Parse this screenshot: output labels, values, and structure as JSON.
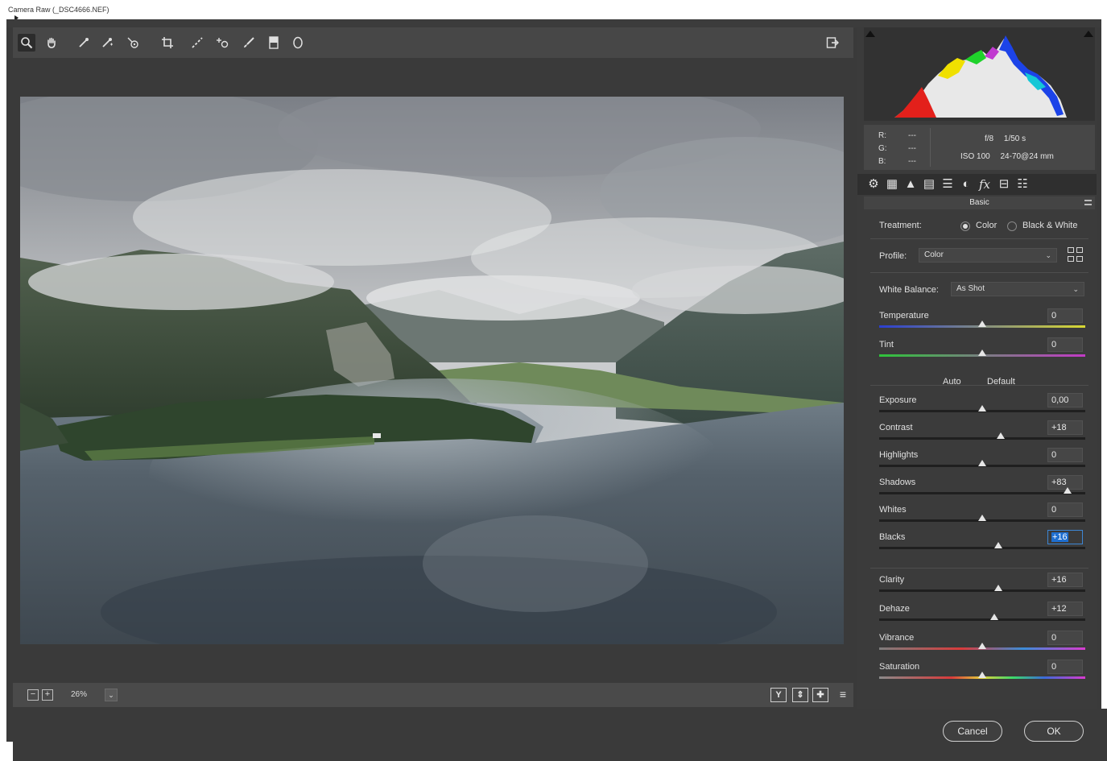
{
  "window": {
    "title": "Camera Raw (_DSC4666.NEF)"
  },
  "toolbar": {
    "tools": [
      {
        "name": "zoom-tool",
        "glyph": "🔍︎"
      },
      {
        "name": "hand-tool",
        "glyph": "✋︎"
      },
      {
        "name": "white-balance-tool",
        "glyph": "⁄"
      },
      {
        "name": "color-sampler-tool",
        "glyph": "⁄"
      },
      {
        "name": "targeted-adjustment-tool",
        "glyph": "◎"
      },
      {
        "name": "crop-tool",
        "glyph": "⌗"
      },
      {
        "name": "straighten-tool",
        "glyph": "⟋"
      },
      {
        "name": "spot-removal-tool",
        "glyph": "⊹"
      },
      {
        "name": "adjustment-brush-tool",
        "glyph": "╱"
      },
      {
        "name": "graduated-filter-tool",
        "glyph": "▣"
      },
      {
        "name": "radial-filter-tool",
        "glyph": "○"
      }
    ],
    "open_preferences_glyph": "⧉"
  },
  "bottom_bar": {
    "zoom_out": "−",
    "zoom_in": "+",
    "zoom_level": "26%",
    "zoom_arrow": "⌄",
    "view_buttons": [
      "Y",
      "⇕",
      "✚",
      "≡"
    ]
  },
  "histogram": {
    "rgb_labels": [
      "R:",
      "G:",
      "B:"
    ],
    "rgb_values": [
      "---",
      "---",
      "---"
    ],
    "aperture": "f/8",
    "shutter": "1/50 s",
    "iso": "ISO 100",
    "lens": "24-70@24 mm"
  },
  "tabs": [
    "⚙",
    "▦",
    "▲",
    "▤",
    "☰",
    "◐",
    "fx",
    "⊟",
    "☷"
  ],
  "panel": {
    "title": "Basic",
    "treatment_label": "Treatment:",
    "treatment_color": "Color",
    "treatment_bw": "Black & White",
    "profile_label": "Profile:",
    "profile_value": "Color",
    "wb_label": "White Balance:",
    "wb_value": "As Shot",
    "auto_link": "Auto",
    "default_link": "Default",
    "sliders": [
      {
        "label": "Temperature",
        "value": "0",
        "position": 0.5
      },
      {
        "label": "Tint",
        "value": "0",
        "position": 0.5
      },
      {
        "label": "Exposure",
        "value": "0,00",
        "position": 0.5
      },
      {
        "label": "Contrast",
        "value": "+18",
        "position": 0.59
      },
      {
        "label": "Highlights",
        "value": "0",
        "position": 0.5
      },
      {
        "label": "Shadows",
        "value": "+83",
        "position": 0.915
      },
      {
        "label": "Whites",
        "value": "0",
        "position": 0.5
      },
      {
        "label": "Blacks",
        "value": "+16",
        "position": 0.58
      },
      {
        "label": "Clarity",
        "value": "+16",
        "position": 0.58
      },
      {
        "label": "Dehaze",
        "value": "+12",
        "position": 0.56
      },
      {
        "label": "Vibrance",
        "value": "0",
        "position": 0.5
      },
      {
        "label": "Saturation",
        "value": "0",
        "position": 0.5
      }
    ]
  },
  "footer": {
    "cancel": "Cancel",
    "ok": "OK"
  },
  "colors": {
    "accent": "#1f6fd0",
    "background": "#3a3a3a"
  }
}
